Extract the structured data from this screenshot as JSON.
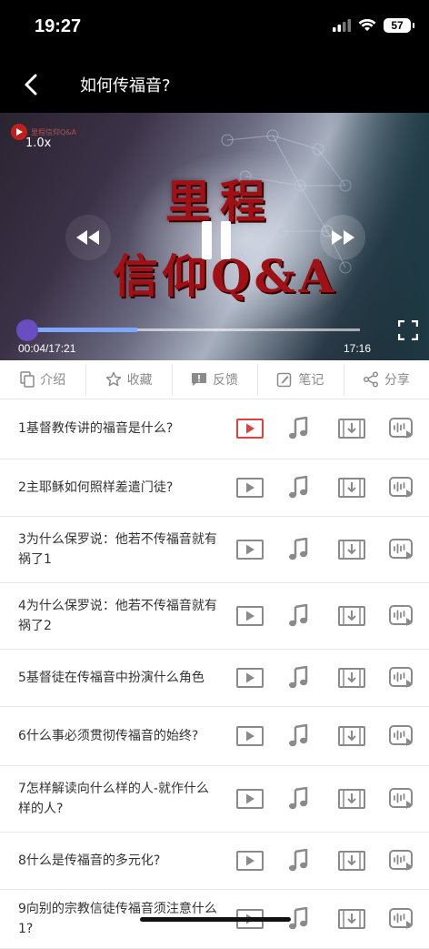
{
  "status": {
    "time": "19:27",
    "battery": "57"
  },
  "header": {
    "title": "如何传福音?"
  },
  "player": {
    "speed": "1.0x",
    "logo_text": "里程信仰Q&A",
    "title_line1": "里程",
    "title_line2": "信仰Q&A",
    "current_time": "00:04/17:21",
    "end_time": "17:16",
    "progress": 0.33
  },
  "tabs": [
    {
      "label": "介绍",
      "icon": "copy-icon"
    },
    {
      "label": "收藏",
      "icon": "star-icon"
    },
    {
      "label": "反馈",
      "icon": "feedback-icon"
    },
    {
      "label": "笔记",
      "icon": "note-icon"
    },
    {
      "label": "分享",
      "icon": "share-icon"
    }
  ],
  "episodes": [
    {
      "title": "1基督教传讲的福音是什么?",
      "active": true
    },
    {
      "title": "2主耶稣如何照样差遣门徒?",
      "active": false
    },
    {
      "title": "3为什么保罗说：他若不传福音就有祸了1",
      "active": false
    },
    {
      "title": "4为什么保罗说：他若不传福音就有祸了2",
      "active": false
    },
    {
      "title": "5基督徒在传福音中扮演什么角色",
      "active": false
    },
    {
      "title": "6什么事必须贯彻传福音的始终?",
      "active": false
    },
    {
      "title": "7怎样解读向什么样的人-就作什么样的人?",
      "active": false
    },
    {
      "title": "8什么是传福音的多元化?",
      "active": false
    },
    {
      "title": "9向别的宗教信徒传福音须注意什么1?",
      "active": false
    }
  ],
  "colors": {
    "accent": "#e0403c",
    "icon_gray": "#8a8a8a",
    "title_red": "#a01014"
  }
}
